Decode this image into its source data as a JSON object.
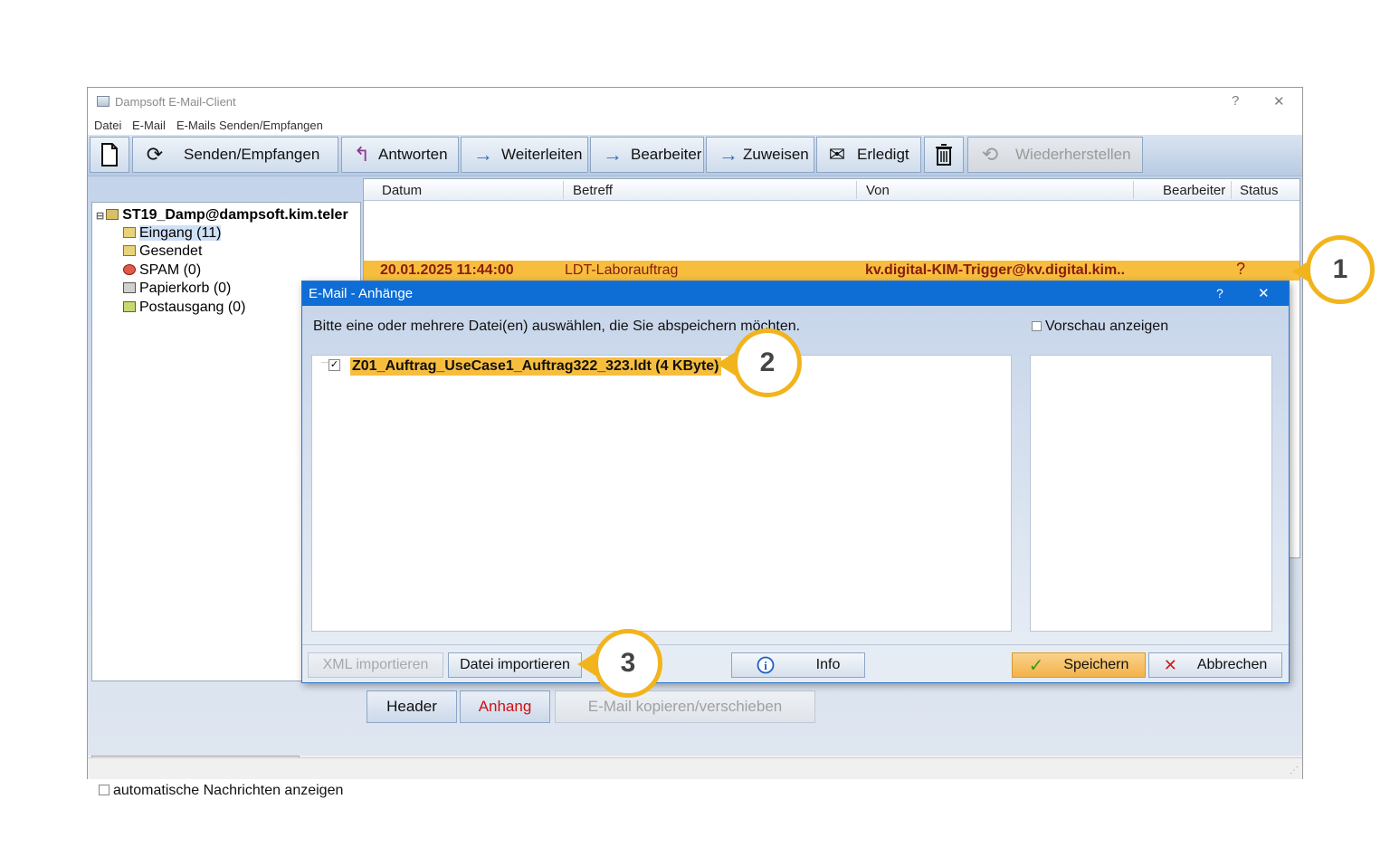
{
  "window": {
    "title": "Dampsoft E-Mail-Client",
    "help": "?",
    "close": "✕"
  },
  "menu": [
    "Datei",
    "E-Mail",
    "E-Mails Senden/Empfangen"
  ],
  "toolbar": {
    "send_receive": "Senden/Empfangen",
    "reply": "Antworten",
    "forward": "Weiterleiten",
    "editor": "Bearbeiter",
    "assign": "Zuweisen",
    "done": "Erledigt",
    "restore": "Wiederherstellen"
  },
  "tree": {
    "account": "ST19_Damp@dampsoft.kim.teler",
    "folders": [
      "Eingang (11)",
      "Gesendet",
      "SPAM (0)",
      "Papierkorb (0)",
      "Postausgang (0)"
    ]
  },
  "auto_messages_label": "automatische Nachrichten anzeigen",
  "list": {
    "columns": [
      "Datum",
      "Betreff",
      "Von",
      "Bearbeiter",
      "Status"
    ],
    "rows": [
      {
        "date": "20.01.2025 11:44:00",
        "subject": "LDT-Laborauftrag",
        "from": "kv.digital-KIM-Trigger@kv.digital.kim..",
        "editor": "",
        "status": "?"
      }
    ]
  },
  "bottom_buttons": {
    "header": "Header",
    "attachment": "Anhang",
    "copy_move": "E-Mail kopieren/verschieben"
  },
  "dialog": {
    "title": "E-Mail - Anhänge",
    "help": "?",
    "close": "✕",
    "instruction": "Bitte eine oder mehrere Datei(en) auswählen, die Sie abspeichern möchten.",
    "preview_label": "Vorschau anzeigen",
    "files": [
      {
        "name": "Z01_Auftrag_UseCase1_Auftrag322_323.ldt (4 KByte)",
        "checked": true
      }
    ],
    "buttons": {
      "xml_import": "XML importieren",
      "file_import": "Datei importieren",
      "info": "Info",
      "save": "Speichern",
      "cancel": "Abbrechen"
    }
  },
  "callouts": [
    "1",
    "2",
    "3"
  ],
  "colors": {
    "highlight": "#f7be3e",
    "callout_ring": "#f2b41d",
    "dialog_title": "#0f6dd6",
    "mail_text": "#8a1c10"
  }
}
